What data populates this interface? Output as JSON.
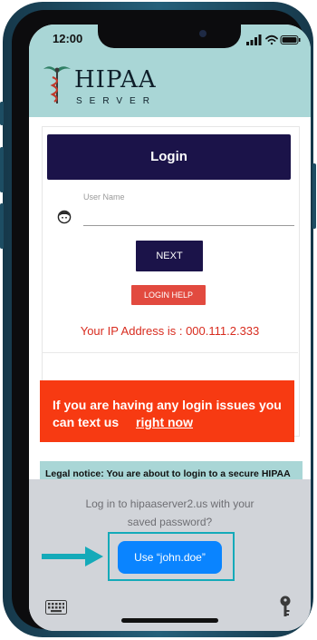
{
  "status_bar": {
    "time": "12:00"
  },
  "header": {
    "logo_main": "HIPAA",
    "logo_sub": "SERVER"
  },
  "login": {
    "title": "Login",
    "username_label": "User Name",
    "next_label": "NEXT",
    "help_label": "LOGIN HELP",
    "ip_text": "Your IP Address is : 000.111.2.333"
  },
  "banner": {
    "line1": "If you are having any login issues you",
    "line2_prefix": "can text us",
    "line2_link": "right now"
  },
  "legal": {
    "text": "Legal notice: You are about to login to a secure HIPAA"
  },
  "password_sheet": {
    "prompt_line1": "Log in to hipaaserver2.us with your",
    "prompt_line2": "saved password?",
    "use_button": "Use “john.doe”"
  },
  "colors": {
    "header_bg": "#a9d6d6",
    "navy": "#1b1349",
    "red_button": "#e24a3f",
    "banner_red": "#f73a12",
    "ios_blue": "#0a84ff",
    "highlight_teal": "#14aab9"
  },
  "icons": [
    "caduceus-icon",
    "signal-icon",
    "wifi-icon",
    "battery-icon",
    "person-icon",
    "arrow-right-icon",
    "keyboard-icon",
    "key-icon"
  ]
}
